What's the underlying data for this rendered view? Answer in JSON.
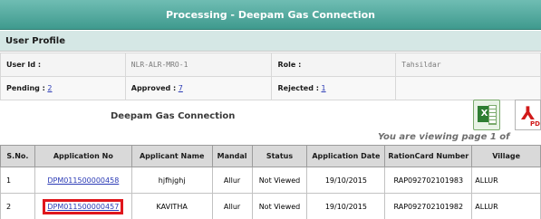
{
  "page_title": "Processing - Deepam Gas Connection",
  "section_title": "User Profile",
  "profile": {
    "user_id_label": "User Id :",
    "user_id_value": "NLR-ALR-MRO-1",
    "role_label": "Role :",
    "role_value": "Tahsildar",
    "pending_label": "Pending :",
    "pending_value": "2",
    "approved_label": "Approved :",
    "approved_value": "7",
    "rejected_label": "Rejected :",
    "rejected_value": "1"
  },
  "table_caption": "Deepam Gas Connection",
  "viewing_text": "You are viewing page 1 of",
  "icons": {
    "export_excel": "excel-icon",
    "export_pdf": "pdf-icon"
  },
  "highlight_color": "#e0161c",
  "columns": [
    "S.No.",
    "Application No",
    "Applicant Name",
    "Mandal",
    "Status",
    "Application Date",
    "RationCard Number",
    "Village"
  ],
  "rows": [
    {
      "sno": "1",
      "app_no": "DPM011500000458",
      "name": "hjfhjghj",
      "mandal": "Allur",
      "status": "Not Viewed",
      "date": "19/10/2015",
      "ration": "RAP092702101983",
      "village": "ALLUR"
    },
    {
      "sno": "2",
      "app_no": "DPM011500000457",
      "name": "KAVITHA",
      "mandal": "Allur",
      "status": "Not Viewed",
      "date": "19/10/2015",
      "ration": "RAP092702101982",
      "village": "ALLUR"
    }
  ]
}
